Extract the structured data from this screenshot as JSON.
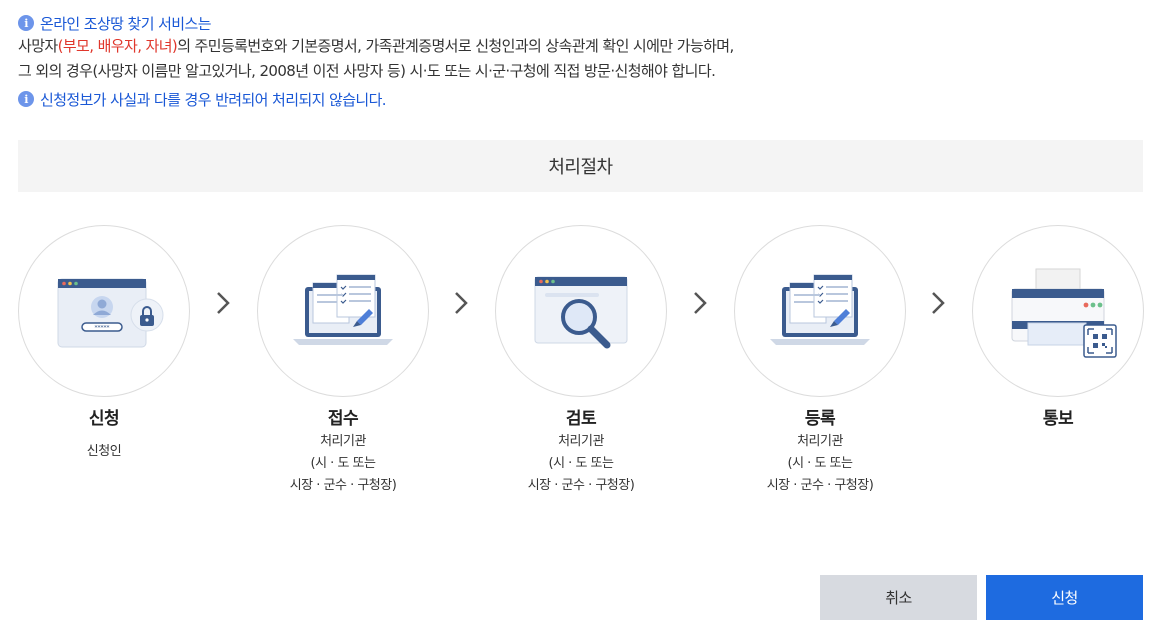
{
  "notice": {
    "line1": "온라인 조상땅 찾기 서비스는",
    "line2_a": "사망자",
    "line2_red": "(부모, 배우자, 자녀)",
    "line2_b": "의 주민등록번호와 기본증명서, 가족관계증명서로 신청인과의 상속관계 확인 시에만 가능하며,",
    "line3": "그 외의 경우(사망자 이름만 알고있거나, 2008년 이전 사망자 등) 시·도 또는 시·군·구청에 직접 방문·신청해야 합니다.",
    "line4": "신청정보가 사실과 다를 경우 반려되어 처리되지 않습니다."
  },
  "process": {
    "header": "처리절차",
    "steps": [
      {
        "title": "신청",
        "sub": [
          "신청인"
        ],
        "icon": "login-screen-icon"
      },
      {
        "title": "접수",
        "sub": [
          "처리기관",
          "(시 · 도 또는",
          "시장 · 군수 · 구청장)"
        ],
        "icon": "laptop-document-icon"
      },
      {
        "title": "검토",
        "sub": [
          "처리기관",
          "(시 · 도 또는",
          "시장 · 군수 · 구청장)"
        ],
        "icon": "magnifier-icon"
      },
      {
        "title": "등록",
        "sub": [
          "처리기관",
          "(시 · 도 또는",
          "시장 · 군수 · 구청장)"
        ],
        "icon": "laptop-document-icon"
      },
      {
        "title": "통보",
        "sub": [],
        "icon": "printer-icon"
      }
    ]
  },
  "buttons": {
    "cancel": "취소",
    "submit": "신청"
  },
  "colors": {
    "accent": "#1e6be0",
    "notice_blue": "#1a58d6",
    "red": "#e0372c",
    "icon_navy": "#3b5b8e"
  }
}
